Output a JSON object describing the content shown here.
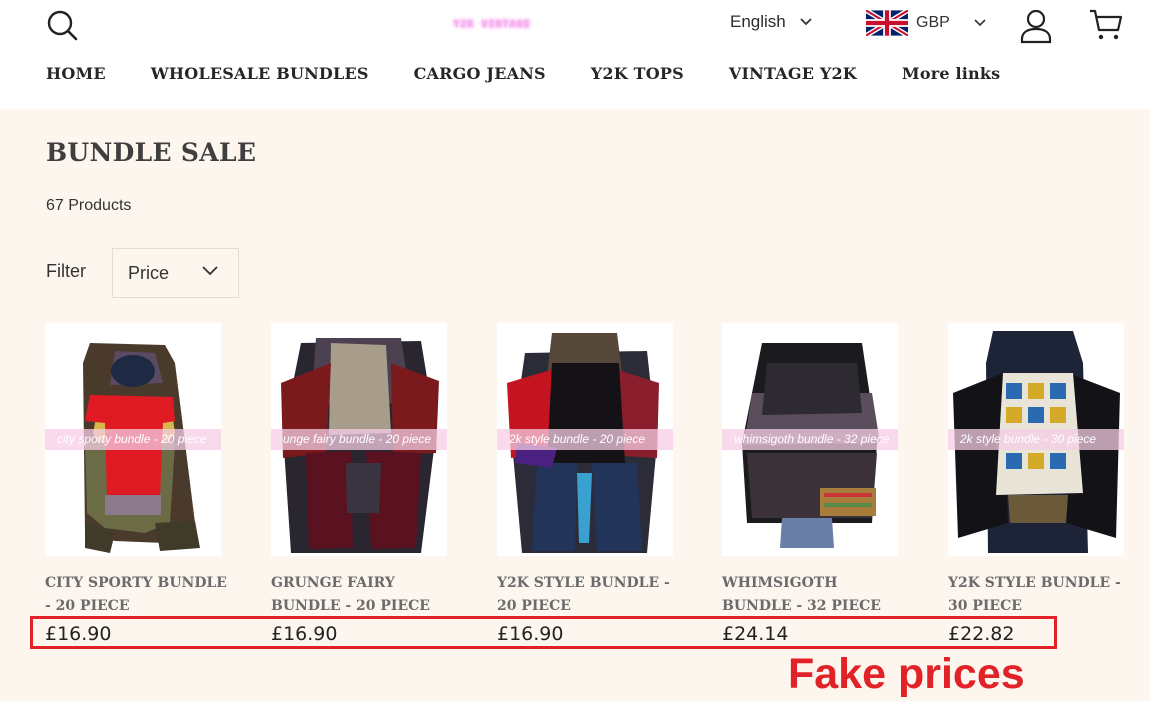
{
  "header": {
    "logo_text": "Y2K VINTAGE",
    "language": "English",
    "currency": "GBP"
  },
  "nav": {
    "items": [
      "HOME",
      "WHOLESALE BUNDLES",
      "CARGO JEANS",
      "Y2K TOPS",
      "VINTAGE Y2K",
      "More links"
    ]
  },
  "collection": {
    "title": "BUNDLE SALE",
    "count": "67 Products",
    "filter_label": "Filter",
    "filter_price": "Price"
  },
  "products": [
    {
      "title": "CITY SPORTY BUNDLE - 20 PIECE",
      "price": "£16.90",
      "band": "city sporty bundle - 20 piece"
    },
    {
      "title": "GRUNGE FAIRY BUNDLE - 20 PIECE",
      "price": "£16.90",
      "band": "unge fairy bundle - 20 piece"
    },
    {
      "title": "Y2K STYLE BUNDLE - 20 PIECE",
      "price": "£16.90",
      "band": "2k style bundle - 20 piece"
    },
    {
      "title": "WHIMSIGOTH BUNDLE - 32 PIECE",
      "price": "£24.14",
      "band": "whimsigoth bundle - 32 piece"
    },
    {
      "title": "Y2K STYLE BUNDLE - 30 PIECE",
      "price": "£22.82",
      "band": "2k style bundle - 30 piece"
    }
  ],
  "annotation": {
    "text": "Fake prices",
    "color": "#e12227"
  }
}
